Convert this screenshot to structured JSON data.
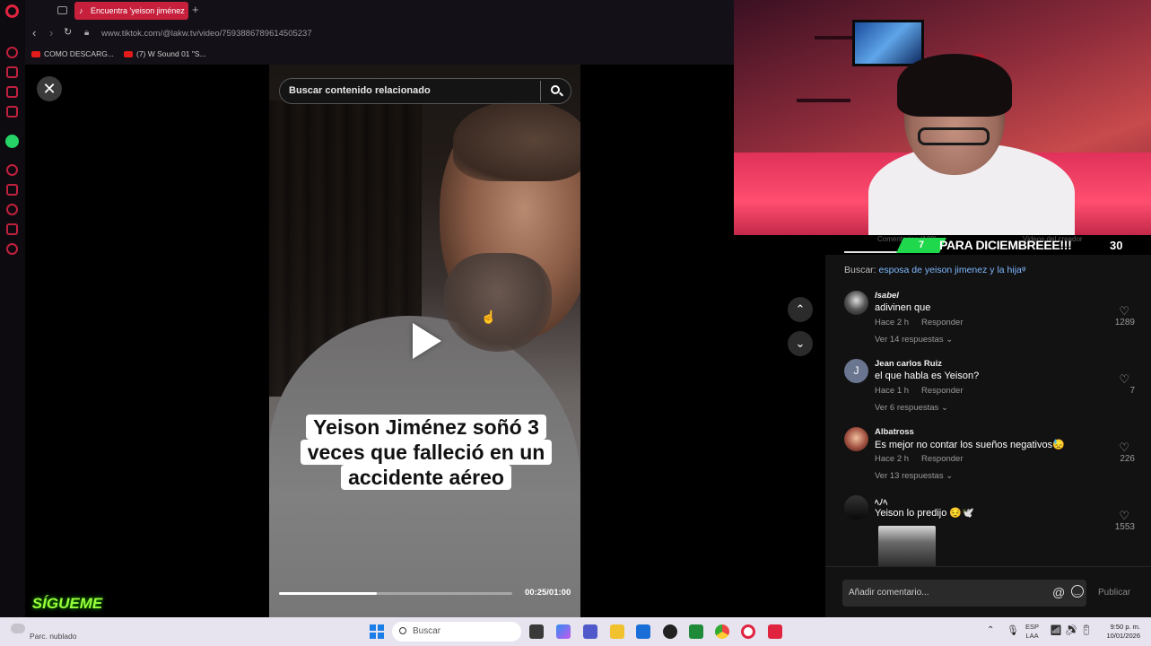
{
  "browser": {
    "tab_title": "Encuentra 'yeison jiménez",
    "url": "www.tiktok.com/@lakw.tv/video/7593886789614505237",
    "bookmarks": [
      "COMO DESCARG...",
      "(7) W Sound 01 \"S..."
    ]
  },
  "video": {
    "search_placeholder": "Buscar contenido relacionado",
    "caption": "Yeison Jiménez soñó 3 veces que falleció en un accidente aéreo",
    "time": "00:25/01:00",
    "progress": 0.42
  },
  "overlay": {
    "banner_number": "7",
    "banner_text": "PARA DICIEMBREEE!!!",
    "banner_count": "30",
    "ghost_left": "Comentarios (120)",
    "ghost_right": "Videos del creador",
    "sigueme": "SÍGUEME"
  },
  "comments": {
    "search_label": "Buscar:",
    "search_query": "esposa de yeison jimenez y la hija",
    "items": [
      {
        "user": "Isabel",
        "text": "adivinen que",
        "time": "Hace 2 h",
        "reply": "Responder",
        "replies": "Ver 14 respuestas",
        "likes": "1289",
        "avatar": ""
      },
      {
        "user": "Jean carlos Ruiz",
        "text": "el que habla es Yeison?",
        "time": "Hace 1 h",
        "reply": "Responder",
        "replies": "Ver 6 respuestas",
        "likes": "7",
        "avatar": "J"
      },
      {
        "user": "Albatross",
        "text": "Es mejor no contar los sueños negativos😓",
        "time": "Hace 2 h",
        "reply": "Responder",
        "replies": "Ver 13 respuestas",
        "likes": "226",
        "avatar": ""
      },
      {
        "user": "ﾍﾉﾍ",
        "text": "Yeison lo predijo 😔🕊️",
        "time": "",
        "reply": "",
        "replies": "",
        "likes": "1553",
        "avatar": ""
      }
    ],
    "input_placeholder": "Añadir comentario...",
    "publish": "Publicar"
  },
  "taskbar": {
    "weather": "Parc. nublado",
    "search": "Buscar",
    "lang_top": "ESP",
    "lang_bottom": "LAA",
    "time": "9:50 p. m.",
    "date": "10/01/2026"
  },
  "colors": {
    "tab_active": "#c6203d",
    "banner_green": "#1fd84c",
    "link_blue": "#7fb8ff"
  }
}
